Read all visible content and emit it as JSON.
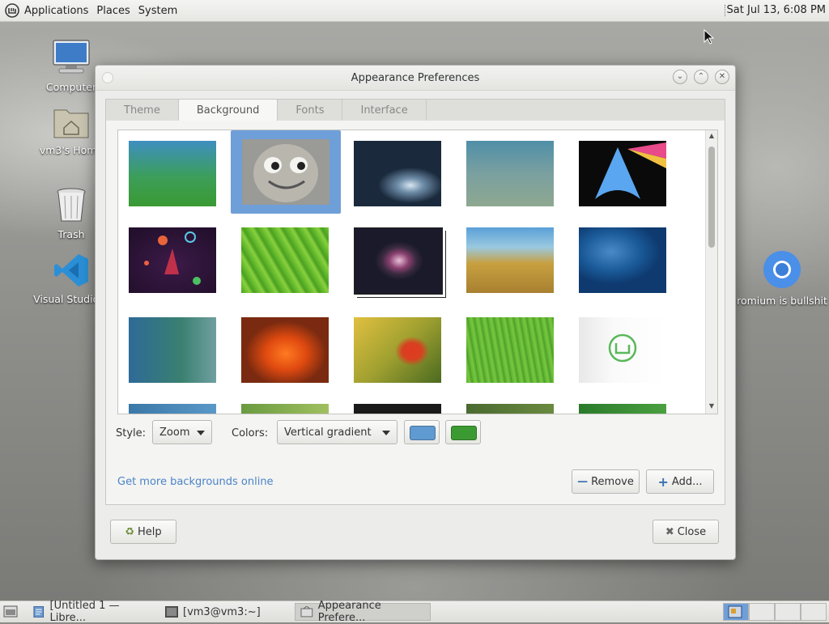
{
  "top_panel": {
    "menus": [
      "Applications",
      "Places",
      "System"
    ],
    "clock": "Sat Jul 13,  6:08 PM"
  },
  "desktop_icons": [
    {
      "label": "Computer",
      "icon": "computer-icon"
    },
    {
      "label": "vm3's Home",
      "icon": "home-folder-icon"
    },
    {
      "label": "Trash",
      "icon": "trash-icon"
    },
    {
      "label": "Visual Studio C",
      "icon": "vscode-icon"
    },
    {
      "label": "romium is bullshit",
      "icon": "chromium-icon"
    }
  ],
  "dialog": {
    "title": "Appearance Preferences",
    "tabs": [
      "Theme",
      "Background",
      "Fonts",
      "Interface"
    ],
    "active_tab": "Background",
    "style_label": "Style:",
    "style_value": "Zoom",
    "colors_label": "Colors:",
    "colors_value": "Vertical gradient",
    "primary_color": "#5f9ad0",
    "secondary_color": "#3c9a32",
    "get_more_link": "Get more backgrounds online",
    "remove_label": "Remove",
    "add_label": "Add...",
    "help_label": "Help",
    "close_label": "Close",
    "selected_wallpaper_index": 1,
    "wallpapers": [
      "blue-green-gradient",
      "smiling-engine-face",
      "water-drop",
      "blue-grey-gradient",
      "arch-prism",
      "purple-planets",
      "green-leaf",
      "nebula",
      "grass-shore",
      "blue-water",
      "teal-bubbles",
      "orange-flower",
      "red-flower",
      "green-grass",
      "mint-logo"
    ]
  },
  "taskbar": {
    "tasks": [
      {
        "label": "[Untitled 1 — Libre...",
        "icon": "document-icon"
      },
      {
        "label": "[vm3@vm3:~]",
        "icon": "terminal-icon"
      },
      {
        "label": "Appearance Prefere...",
        "icon": "preferences-icon"
      }
    ],
    "workspaces": 4,
    "active_workspace": 0
  }
}
